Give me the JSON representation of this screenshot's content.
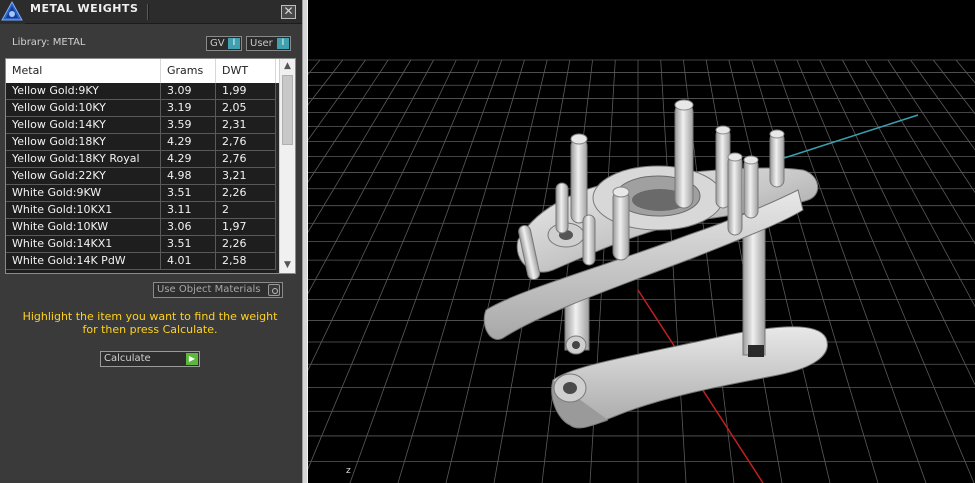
{
  "panel": {
    "title": "METAL WEIGHTS",
    "close_symbol": "✕",
    "library_label": "Library: METAL",
    "gv_label": "GV",
    "gv_toggle": "I",
    "user_label": "User",
    "user_toggle": "I"
  },
  "table": {
    "headers": [
      "Metal",
      "Grams",
      "DWT"
    ],
    "rows": [
      [
        "Yellow Gold:9KY",
        "3.09",
        "1,99"
      ],
      [
        "Yellow Gold:10KY",
        "3.19",
        "2,05"
      ],
      [
        "Yellow Gold:14KY",
        "3.59",
        "2,31"
      ],
      [
        "Yellow Gold:18KY",
        "4.29",
        "2,76"
      ],
      [
        "Yellow Gold:18KY Royal",
        "4.29",
        "2,76"
      ],
      [
        "Yellow Gold:22KY",
        "4.98",
        "3,21"
      ],
      [
        "White Gold:9KW",
        "3.51",
        "2,26"
      ],
      [
        "White Gold:10KX1",
        "3.11",
        "2"
      ],
      [
        "White Gold:10KW",
        "3.06",
        "1,97"
      ],
      [
        "White Gold:14KX1",
        "3.51",
        "2,26"
      ],
      [
        "White Gold:14K PdW",
        "4.01",
        "2,58"
      ]
    ]
  },
  "use_object_materials_label": "Use Object Materials",
  "hint_line1": "Highlight the item you want to find the weight",
  "hint_line2": "for then press Calculate.",
  "calculate_label": "Calculate",
  "calculate_icon": "▶",
  "viewport": {
    "axis_label": "z"
  },
  "colors": {
    "hint": "#ffd21f",
    "toggle_accent": "#40a0b0",
    "calculate_go": "#5ab83a",
    "grid": "#5a5a5a",
    "x_axis": "#c02020",
    "y_axis": "#3aa0b0"
  }
}
